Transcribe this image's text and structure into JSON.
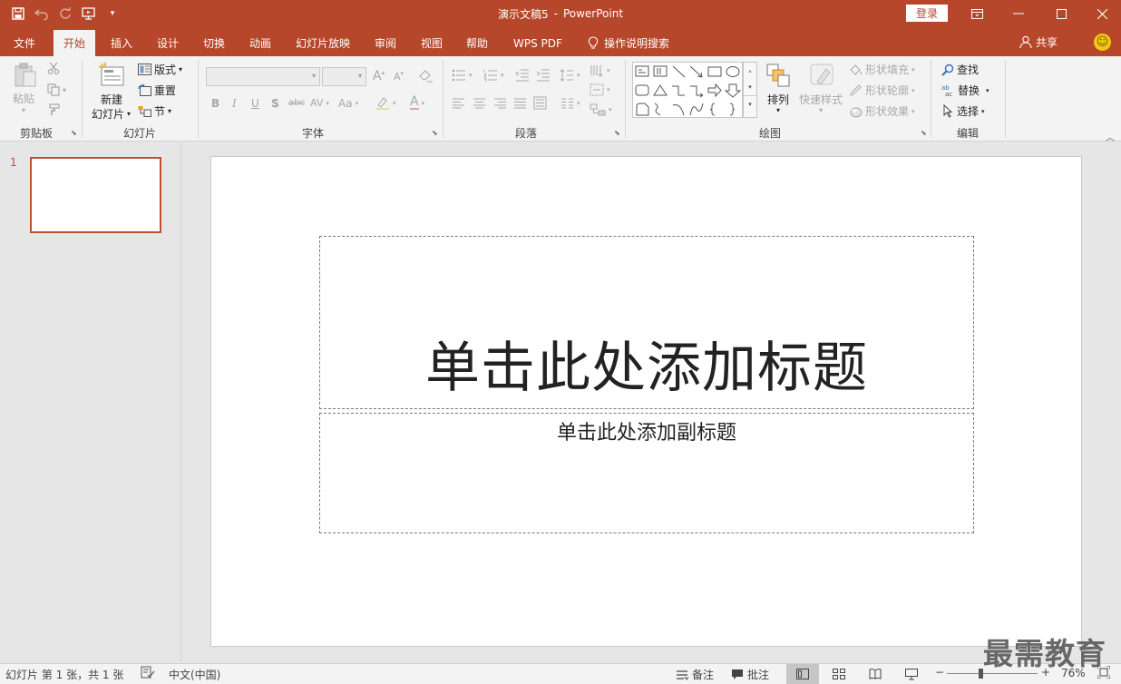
{
  "colors": {
    "accent": "#b7472a",
    "ribbon_bg": "#f3f3f3",
    "workspace_bg": "#e6e6e6"
  },
  "titlebar": {
    "doc_name": "演示文稿5",
    "separator": "-",
    "app_name": "PowerPoint",
    "login": "登录",
    "icons": [
      "save-icon",
      "undo-icon",
      "redo-icon",
      "start-from-beginning-icon",
      "customize-qat-icon",
      "ribbon-display-icon",
      "minimize-icon",
      "maximize-icon",
      "close-icon"
    ]
  },
  "tabs": [
    "文件",
    "开始",
    "插入",
    "设计",
    "切换",
    "动画",
    "幻灯片放映",
    "审阅",
    "视图",
    "帮助",
    "WPS PDF",
    "操作说明搜索"
  ],
  "active_tab": "开始",
  "share": "共享",
  "ribbon": {
    "clipboard": {
      "label": "剪贴板",
      "paste": "粘贴"
    },
    "slides": {
      "label": "幻灯片",
      "new_slide_1": "新建",
      "new_slide_2": "幻灯片",
      "layout": "版式",
      "reset": "重置",
      "section": "节"
    },
    "font": {
      "label": "字体",
      "bold": "B",
      "italic": "I",
      "underline": "U",
      "shadow": "S",
      "strike": "abc",
      "spacing": "AV",
      "case": "Aa",
      "grow": "A",
      "shrink": "A"
    },
    "paragraph": {
      "label": "段落"
    },
    "drawing": {
      "label": "绘图",
      "arrange": "排列",
      "quick_styles": "快速样式",
      "shape_fill": "形状填充",
      "shape_outline": "形状轮廓",
      "shape_effects": "形状效果"
    },
    "editing": {
      "label": "编辑",
      "find": "查找",
      "replace": "替换",
      "select": "选择"
    }
  },
  "thumbnail": {
    "number": "1"
  },
  "slide": {
    "title_placeholder": "单击此处添加标题",
    "subtitle_placeholder": "单击此处添加副标题"
  },
  "statusbar": {
    "slide_info": "幻灯片 第 1 张，共 1 张",
    "language": "中文(中国)",
    "notes": "备注",
    "comments": "批注",
    "zoom_minus": "−",
    "zoom_plus": "+",
    "zoom": "76%",
    "zoom_level_percent": 76
  },
  "watermark": "最需教育"
}
